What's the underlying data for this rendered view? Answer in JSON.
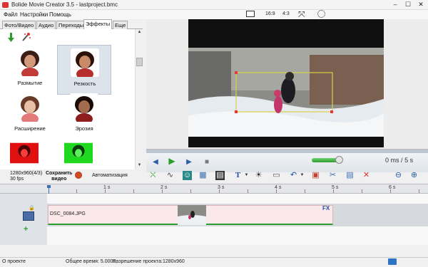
{
  "window": {
    "title": "Bolide Movie Creator 3.5 - lastproject.bmc",
    "minimize": "–",
    "maximize": "☐",
    "close": "✕"
  },
  "menu": [
    "Файл",
    "Настройки",
    "Помощь"
  ],
  "aspect": {
    "ratio_16_9": "16:9",
    "ratio_4_3": "4:3"
  },
  "tabs": [
    {
      "label": "Фото/Видео",
      "active": false
    },
    {
      "label": "Аудио",
      "active": false
    },
    {
      "label": "Переходы",
      "active": false
    },
    {
      "label": "Эффекты",
      "active": true
    },
    {
      "label": "Еще",
      "active": false
    }
  ],
  "effects": [
    {
      "label": "Размытие",
      "style": "normal"
    },
    {
      "label": "Резкость",
      "style": "normal"
    },
    {
      "label": "Расширение",
      "style": "normal"
    },
    {
      "label": "Эрозия",
      "style": "normal"
    },
    {
      "label": "",
      "style": "red"
    },
    {
      "label": "",
      "style": "green"
    }
  ],
  "player": {
    "time_current": "0 ms",
    "separator": "/",
    "time_total": "5 s"
  },
  "project": {
    "resolution": "1280x960(4/3)",
    "fps": "30 fps",
    "save_line1": "Сохранить",
    "save_line2": "видео",
    "automation": "Автоматизация"
  },
  "ruler": {
    "labels": [
      "1 s",
      "2 s",
      "3 s",
      "4 s",
      "5 s",
      "6 s"
    ]
  },
  "timeline": {
    "clip_name": "DSC_0084.JPG",
    "fx": "FX",
    "lock": "🔒",
    "add": "+"
  },
  "status": {
    "about": "О проекте",
    "total_time": "Общее время: 5.000s,",
    "resolution": "Разрешение проекта:",
    "resolution_value": "1280x960"
  },
  "colors": {
    "accent_blue": "#2b5fa8",
    "green": "#2a9d2a",
    "clip_bg": "#fbe8ea",
    "record_orange": "#d34c1a"
  },
  "icons": [
    "arrow-down-icon",
    "magic-wand-icon",
    "play-icon",
    "rewind-icon",
    "forward-icon",
    "stop-icon",
    "record-icon",
    "zoom-in-icon",
    "zoom-out-icon",
    "delete-icon",
    "undo-icon",
    "text-icon",
    "brightness-icon",
    "fullscreen-icon"
  ]
}
